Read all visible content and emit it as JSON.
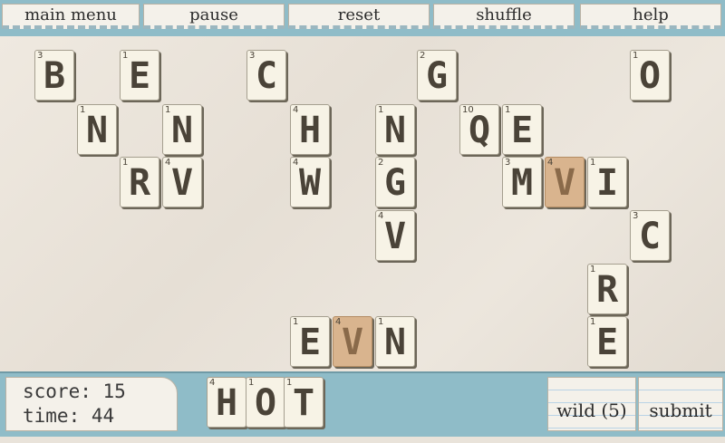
{
  "menu": {
    "main_menu": "main menu",
    "pause": "pause",
    "reset": "reset",
    "shuffle": "shuffle",
    "help": "help"
  },
  "status": {
    "score_label": "score: 15",
    "time_label": "time: 44"
  },
  "buttons": {
    "wild": "wild (5)",
    "submit": "submit"
  },
  "board_tiles": [
    {
      "letter": "B",
      "points": "3"
    },
    {
      "letter": "E",
      "points": "1"
    },
    {
      "letter": "N",
      "points": "1"
    },
    {
      "letter": "N",
      "points": "1"
    },
    {
      "letter": "R",
      "points": "1"
    },
    {
      "letter": "V",
      "points": "4"
    },
    {
      "letter": "C",
      "points": "3"
    },
    {
      "letter": "H",
      "points": "4"
    },
    {
      "letter": "W",
      "points": "4"
    },
    {
      "letter": "N",
      "points": "1"
    },
    {
      "letter": "G",
      "points": "2"
    },
    {
      "letter": "V",
      "points": "4"
    },
    {
      "letter": "G",
      "points": "2"
    },
    {
      "letter": "Q",
      "points": "10"
    },
    {
      "letter": "E",
      "points": "1"
    },
    {
      "letter": "M",
      "points": "3"
    },
    {
      "letter": "V",
      "points": "4",
      "wild": true
    },
    {
      "letter": "I",
      "points": "1"
    },
    {
      "letter": "O",
      "points": "1"
    },
    {
      "letter": "C",
      "points": "3"
    },
    {
      "letter": "R",
      "points": "1"
    },
    {
      "letter": "E",
      "points": "1"
    },
    {
      "letter": "E",
      "points": "1"
    },
    {
      "letter": "V",
      "points": "4",
      "wild": true
    },
    {
      "letter": "N",
      "points": "1"
    }
  ],
  "rack_tiles": [
    {
      "letter": "H",
      "points": "4"
    },
    {
      "letter": "O",
      "points": "1"
    },
    {
      "letter": "T",
      "points": "1"
    }
  ],
  "colors": {
    "bar": "#8fbcc8",
    "tile": "#f7f3e6",
    "wild_tile": "#d9b48e"
  }
}
